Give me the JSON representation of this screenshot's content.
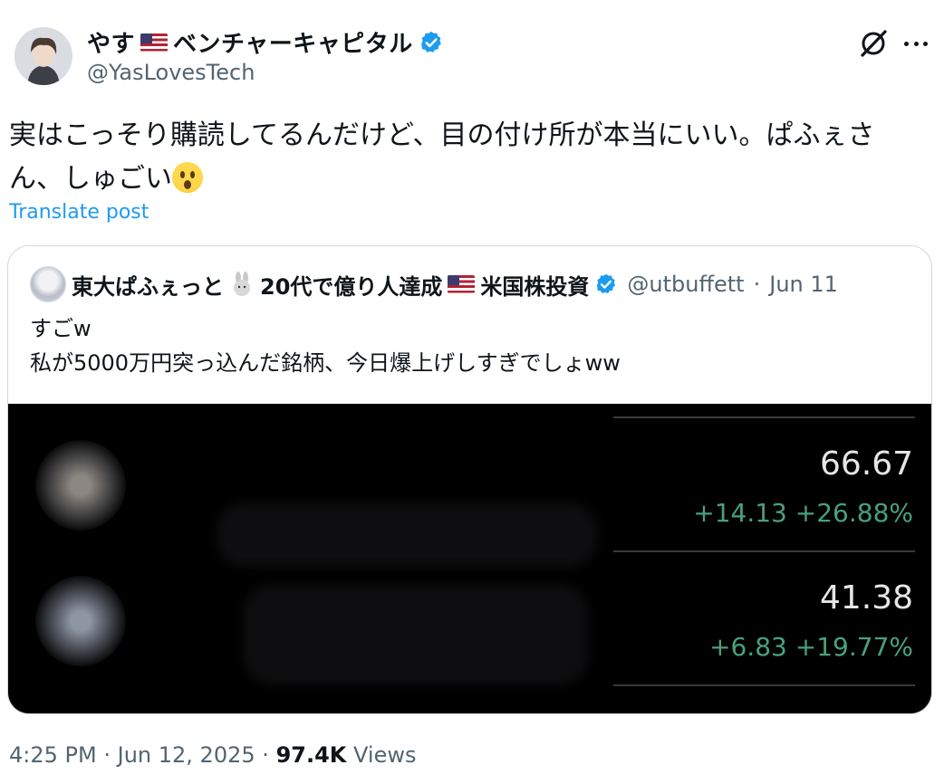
{
  "author": {
    "name_prefix": "やす",
    "name_suffix": "ベンチャーキャピタル",
    "handle": "@YasLovesTech"
  },
  "tweet": {
    "text": "実はこっそり購読してるんだけど、目の付け所が本当にいい。ぱふぇさん、しゅごい",
    "translate_label": "Translate post"
  },
  "quoted": {
    "name_part1": "東大ぱふぇっと",
    "name_part2": "20代で億り人達成",
    "name_part3": "米国株投資",
    "handle": "@utbuffett",
    "separator": "·",
    "date": "Jun 11",
    "line1": "すごw",
    "line2": "私が5000万円突っ込んだ銘柄、今日爆上げしすぎでしょww",
    "quotes": [
      {
        "price": "66.67",
        "change": "+14.13 +26.88%"
      },
      {
        "price": "41.38",
        "change": "+6.83 +19.77%"
      }
    ]
  },
  "meta": {
    "time": "4:25 PM",
    "dot1": "·",
    "date": "Jun 12, 2025",
    "dot2": "·",
    "views": "97.4K",
    "views_label": "Views"
  },
  "colors": {
    "link": "#1d9bf0",
    "verified": "#1d9bf0",
    "stock_gain": "#49a17c"
  },
  "icons": [
    "verified-badge-icon",
    "grok-icon",
    "more-icon",
    "us-flag-icon",
    "rabbit-icon",
    "astonished-face-icon"
  ]
}
